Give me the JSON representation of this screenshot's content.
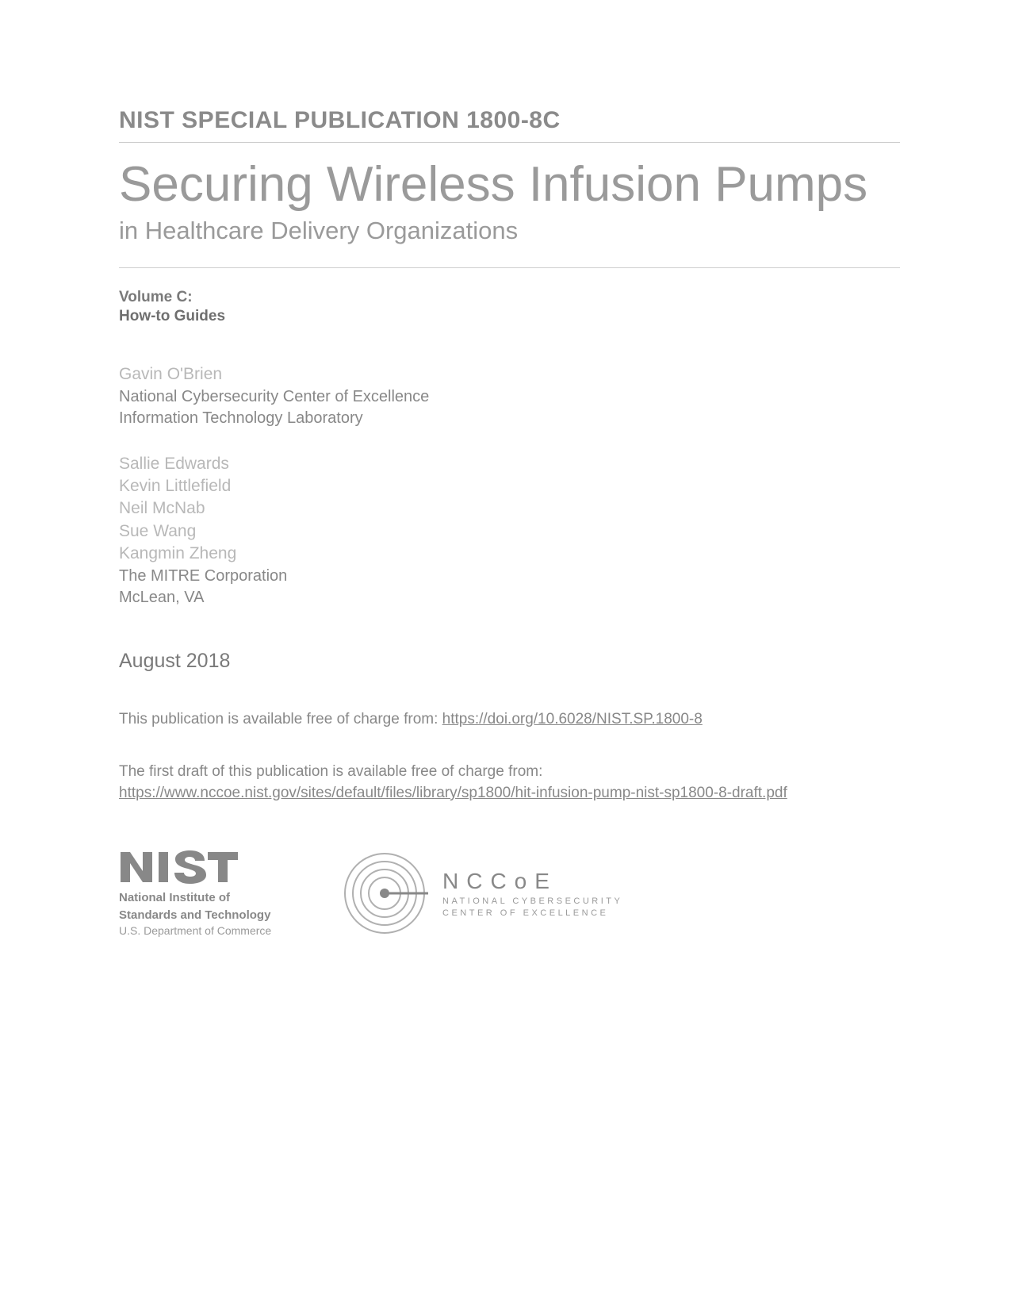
{
  "publication_id": "NIST SPECIAL PUBLICATION 1800-8C",
  "title": "Securing Wireless Infusion Pumps",
  "subtitle": "in Healthcare Delivery Organizations",
  "volume_label": "Volume C:",
  "volume_name": "How-to Guides",
  "author_groups": [
    {
      "names": [
        "Gavin O'Brien"
      ],
      "affiliation": [
        "National Cybersecurity Center of Excellence",
        "Information Technology Laboratory"
      ]
    },
    {
      "names": [
        "Sallie Edwards",
        "Kevin Littlefield",
        "Neil McNab",
        "Sue Wang",
        "Kangmin Zheng"
      ],
      "affiliation": [
        "The MITRE Corporation",
        "McLean, VA"
      ]
    }
  ],
  "date": "August 2018",
  "availability": {
    "prefix": "This publication is available free of charge from: ",
    "link": "https://doi.org/10.6028/NIST.SP.1800-8"
  },
  "draft": {
    "prefix": "The first draft of this publication is available free of charge from:",
    "link": "https://www.nccoe.nist.gov/sites/default/files/library/sp1800/hit-infusion-pump-nist-sp1800-8-draft.pdf"
  },
  "logos": {
    "nist": {
      "wordmark": "NIST",
      "line1": "National Institute of",
      "line2": "Standards and Technology",
      "line3": "U.S. Department of Commerce"
    },
    "nccoe": {
      "wordmark": "NCCoE",
      "line1": "NATIONAL CYBERSECURITY",
      "line2": "CENTER OF EXCELLENCE"
    }
  }
}
